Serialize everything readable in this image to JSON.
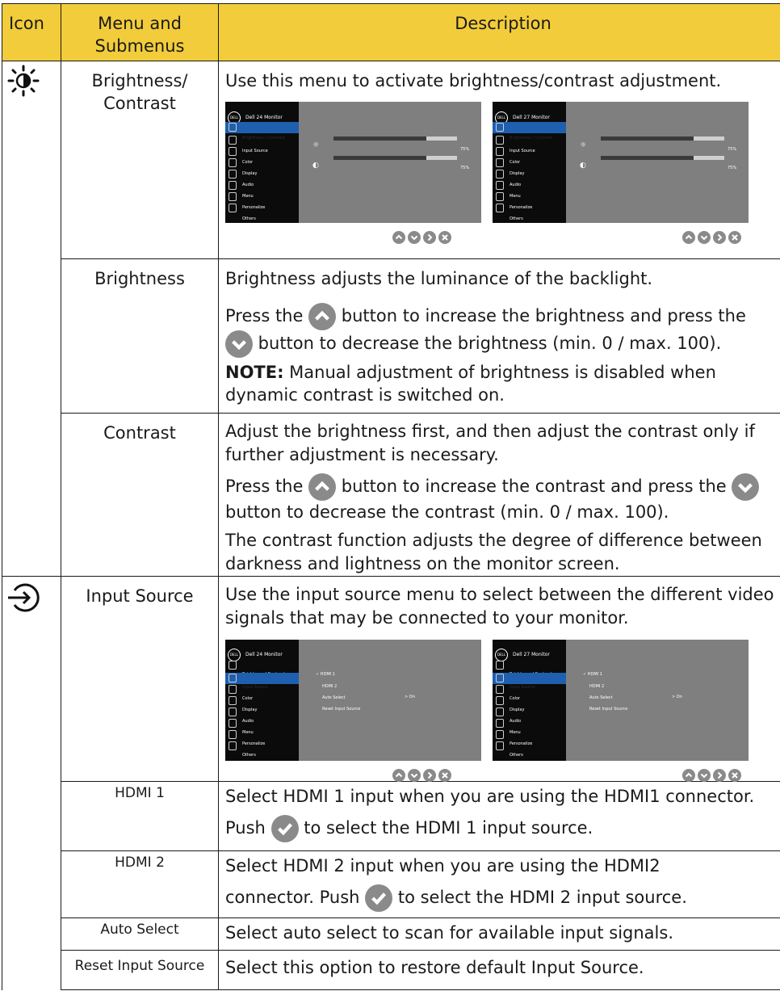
{
  "header": {
    "icon": "Icon",
    "menu": "Menu and Submenus",
    "description": "Description"
  },
  "osd": {
    "monitor_left": "Dell 24 Monitor",
    "monitor_right": "Dell 27 Monitor",
    "logo": "DELL",
    "menu_items": [
      "Brightness / Contrast",
      "Input Source",
      "Color",
      "Display",
      "Audio",
      "Menu",
      "Personalize",
      "Others"
    ],
    "brightness_pct": "75%",
    "contrast_pct": "75%",
    "brightness_level": 0.75,
    "contrast_level": 0.75,
    "input_options": [
      "✓ HDMI 1",
      "HDMI 2",
      "Auto Select",
      "Reset Input Source"
    ],
    "auto_select_value": ">  On"
  },
  "rows": {
    "brightness_contrast": {
      "menu": "Brightness/ Contrast",
      "desc": "Use this menu to activate brightness/contrast adjustment."
    },
    "brightness": {
      "menu": "Brightness",
      "p1": "Brightness adjusts the luminance of the backlight.",
      "p2a": "Press the ",
      "p2b": " button to increase the brightness and press the",
      "p2c": " button to decrease the brightness (min. 0 / max. 100).",
      "note_label": "NOTE:",
      "note_text": " Manual adjustment of brightness is disabled when dynamic contrast is switched on."
    },
    "contrast": {
      "menu": "Contrast",
      "p1": "Adjust the brightness first, and then adjust the contrast only if further adjustment is necessary.",
      "p2a": "Press the ",
      "p2b": " button to increase the contrast and press the ",
      "p2c": "button to decrease the contrast (min. 0 / max. 100).",
      "p3": "The contrast function adjusts the degree of difference between darkness and lightness on the monitor screen."
    },
    "input_source": {
      "menu": "Input Source",
      "desc": "Use the input source menu to select between the different video signals that may be connected to your monitor."
    },
    "hdmi1": {
      "menu": "HDMI 1",
      "p1": "Select HDMI 1 input when you are using the HDMI1 connector.",
      "p2a": "Push ",
      "p2b": " to select the HDMI 1 input source."
    },
    "hdmi2": {
      "menu": "HDMI 2",
      "p1": "Select HDMI 2 input when you are using the HDMI2",
      "p2a": "connector. Push ",
      "p2b": " to select the HDMI 2 input source."
    },
    "auto_select": {
      "menu": "Auto Select",
      "desc": "Select auto select to scan for available input signals."
    },
    "reset_input": {
      "menu": "Reset Input Source",
      "desc": "Select this option to restore default Input Source."
    }
  },
  "colors": {
    "header_bg": "#f2cc3a",
    "button": "#8a8a8a",
    "osd_bg": "#7f7f7f",
    "osd_side": "#0b0b0b",
    "osd_selected": "#1f5fb0"
  }
}
